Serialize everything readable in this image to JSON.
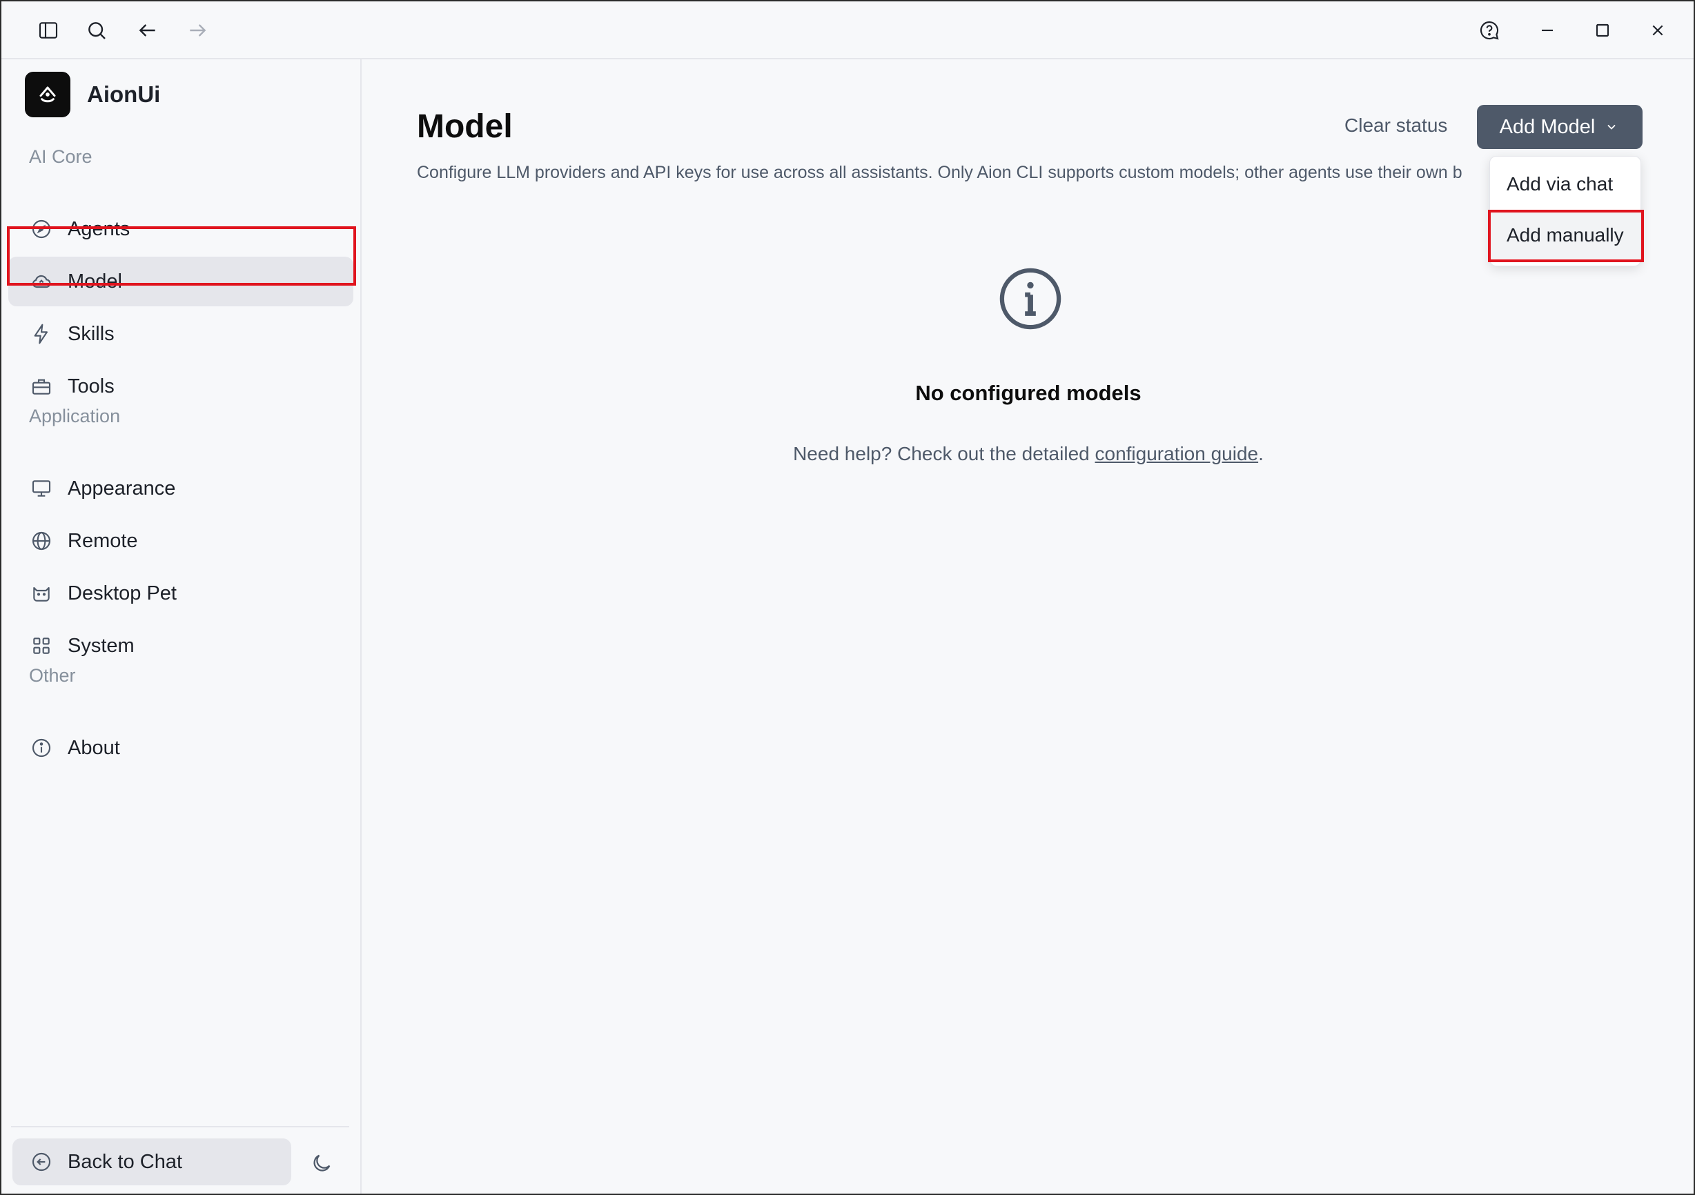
{
  "app": {
    "name": "AionUi"
  },
  "titlebar": {
    "icons": [
      "sidebar-toggle-icon",
      "search-icon",
      "arrow-left-icon",
      "arrow-right-icon",
      "help-chat-icon",
      "minimize-icon",
      "maximize-icon",
      "close-icon"
    ]
  },
  "sidebar": {
    "sections": [
      {
        "label": "AI Core",
        "items": [
          {
            "label": "Agents",
            "icon": "compass-icon"
          },
          {
            "label": "Model",
            "icon": "cloud-icon",
            "active": true
          },
          {
            "label": "Skills",
            "icon": "lightning-icon"
          },
          {
            "label": "Tools",
            "icon": "toolbox-icon"
          }
        ]
      },
      {
        "label": "Application",
        "items": [
          {
            "label": "Appearance",
            "icon": "monitor-icon"
          },
          {
            "label": "Remote",
            "icon": "globe-icon"
          },
          {
            "label": "Desktop Pet",
            "icon": "cat-icon"
          },
          {
            "label": "System",
            "icon": "grid-icon"
          }
        ]
      },
      {
        "label": "Other",
        "items": [
          {
            "label": "About",
            "icon": "info-icon"
          }
        ]
      }
    ],
    "back_label": "Back to Chat"
  },
  "main": {
    "title": "Model",
    "description": "Configure LLM providers and API keys for use across all assistants. Only Aion CLI supports custom models; other agents use their own b",
    "clear_status": "Clear status",
    "add_model": "Add Model",
    "dropdown": [
      "Add via chat",
      "Add manually"
    ],
    "empty": {
      "title": "No configured models",
      "help_prefix": "Need help? Check out the detailed ",
      "help_link": "configuration guide",
      "help_suffix": "."
    }
  },
  "colors": {
    "accent_button": "#4e5969",
    "highlight": "#e0141e",
    "active_item": "#e5e6eb"
  }
}
